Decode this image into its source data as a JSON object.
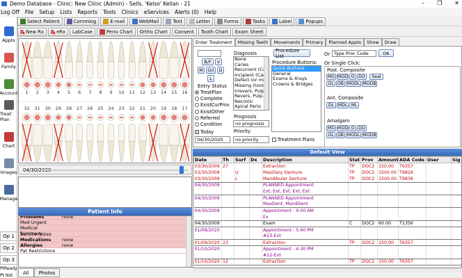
{
  "window": {
    "title": "Demo Database - Clinic: New Clinic (Admin) - Sells, 'Kelso' Kellan - 21"
  },
  "menu": [
    "Log Off",
    "File",
    "Setup",
    "Lists",
    "Reports",
    "Tools",
    "Clinics",
    "eServices",
    "Alerts (0)",
    "Help"
  ],
  "toolbar1": [
    {
      "label": "Select Patient",
      "icon": "person-icon",
      "color": "#3a7d2b"
    },
    {
      "label": "Commlog",
      "icon": "phone-icon",
      "color": "#5b5b9a"
    },
    {
      "label": "E-mail",
      "icon": "email-icon",
      "color": "#c9a227"
    },
    {
      "label": "WebMail",
      "icon": "webmail-icon",
      "color": "#3d72c4"
    },
    {
      "label": "Text",
      "icon": "text-icon",
      "color": "#9aa6b6"
    },
    {
      "label": "Letter",
      "icon": "letter-icon",
      "color": "#bdbdbd"
    },
    {
      "label": "Forms",
      "icon": "forms-icon",
      "color": "#8a8a8a"
    },
    {
      "label": "Tasks",
      "icon": "tasks-icon",
      "color": "#b23a3a"
    },
    {
      "label": "Label",
      "icon": "label-icon",
      "color": "#3d72c4"
    },
    {
      "label": "Popups",
      "icon": "popups-icon",
      "color": "#5b8bd4"
    }
  ],
  "toolbar2": [
    {
      "label": "New Rx",
      "rx": true
    },
    {
      "label": "eRx",
      "rx": true
    },
    {
      "label": "LabCase"
    },
    {
      "label": "Perio Chart",
      "icon": "perio-icon"
    },
    {
      "label": "Ortho Chart"
    },
    {
      "label": "Consent"
    },
    {
      "label": "Tooth Chart"
    },
    {
      "label": "Exam Sheet"
    }
  ],
  "sidebar": [
    {
      "label": "Appts",
      "color": "#2f6bd0"
    },
    {
      "label": "Family",
      "color": "#d5564e"
    },
    {
      "label": "Account",
      "color": "#4f8c3a"
    },
    {
      "label": "Treat' Plan",
      "color": "#5a5a5a"
    },
    {
      "label": "Chart",
      "color": "#c23b3b"
    },
    {
      "label": "Images",
      "color": "#7a8ca5"
    },
    {
      "label": "Manage",
      "color": "#4b6b9e"
    }
  ],
  "ops": [
    "Op 1",
    "Op 2",
    "Op 3"
  ],
  "sidebar_bottom": [
    "PtReady",
    "Pt Not"
  ],
  "tooth_chart": {
    "upper_numbers": [
      "1",
      "2",
      "3",
      "4",
      "5",
      "6",
      "7",
      "8",
      "9",
      "10",
      "11",
      "12",
      "13",
      "14",
      "15",
      "16"
    ],
    "lower_numbers": [
      "32",
      "31",
      "30",
      "29",
      "28",
      "27",
      "26",
      "25",
      "24",
      "23",
      "22",
      "21",
      "20",
      "19",
      "18",
      "17"
    ],
    "missing_teeth": [
      "1",
      "4",
      "13",
      "16",
      "32",
      "29",
      "20",
      "17"
    ]
  },
  "chart_date": "04/30/2020",
  "patient_info": {
    "title": "Patient Info",
    "rows": [
      {
        "k": "Problems",
        "v": "none",
        "pink": true,
        "bold": true
      },
      {
        "k": "Med Urgent",
        "v": "",
        "pink": true
      },
      {
        "k": "Medical Summary",
        "v": "",
        "pink": true
      },
      {
        "k": "Service Notes",
        "v": "",
        "pink": true
      },
      {
        "k": "Medications",
        "v": "none",
        "pink": true,
        "bold": true
      },
      {
        "k": "Allergies",
        "v": "none",
        "pink": true,
        "bold": true
      },
      {
        "k": "Pat Restrictions",
        "v": "",
        "pink": false
      }
    ]
  },
  "bottom_tabs": [
    "All",
    "Photos"
  ],
  "tx_tabs": [
    "Enter Treatment",
    "Missing Teeth",
    "Movements",
    "Primary",
    "Planned Appts",
    "Show",
    "Draw"
  ],
  "enter_tx": {
    "surf_buttons_row1": [
      "B/F",
      "V"
    ],
    "surf_buttons_row2": [
      "M",
      "O/I",
      "D"
    ],
    "surf_buttons_row3": [
      "L"
    ],
    "entry_status_label": "Entry Status",
    "statuses": [
      {
        "label": "TreatPlan",
        "on": true
      },
      {
        "label": "Complete",
        "on": false
      },
      {
        "label": "ExistCurProv",
        "on": false
      },
      {
        "label": "ExistOther",
        "on": false
      },
      {
        "label": "Referred",
        "on": false
      },
      {
        "label": "Condition",
        "on": false
      }
    ],
    "today_label": "Today",
    "today_checked": true,
    "date_value": "04/30/2020",
    "diagnosis_label": "Diagnosis",
    "diagnosis_items": [
      "None",
      "Caries",
      "Recurrent (Car)",
      "Incipient (Car)",
      "Defect (or miss",
      "Missing (tooth",
      "Irrevers. Pulp.",
      "Revers. Pulp.",
      "Necrotic",
      "Apical Perio"
    ],
    "prognosis_label": "Prognosis",
    "prognosis_value": "no prognosis",
    "priority_label": "Priority",
    "priority_value": "no priority",
    "treatment_plans_label": "Treatment Plans",
    "procedure_list_btn": "Procedure List",
    "proc_buttons_label": "Procedure Buttons:",
    "proc_categories": [
      "Quick Buttons",
      "General",
      "Exams & Xrays",
      "Crowns & Bridges"
    ],
    "or_label": "Or",
    "type_proc_placeholder": "Type Proc Code",
    "ok_label": "OK",
    "single_click_label": "Or Single Click:",
    "post_composite_label": "Post. Composite",
    "post_row1": [
      "MO",
      "MOD",
      "O",
      "DO"
    ],
    "seal_label": "Seal",
    "post_row2": [
      "OL",
      "OB",
      "MODL",
      "MODB"
    ],
    "ant_composite_label": "Ant. Composite",
    "ant_row": [
      "DL",
      "MDL",
      "ML"
    ],
    "amalgam_label": "Amalgam",
    "amal_row1": [
      "MO",
      "MOD",
      "O",
      "DO"
    ],
    "amal_row2": [
      "OL",
      "OB",
      "MODL",
      "MODB"
    ]
  },
  "grid": {
    "title": "Default View",
    "columns": [
      "Date",
      "Th",
      "Surf",
      "Dx",
      "Description",
      "Stat",
      "Prov",
      "Amount",
      "ADA Code",
      "User",
      "Sig"
    ],
    "rows": [
      {
        "cells": [
          "03/30/2009",
          "27",
          "",
          "",
          "Extraction",
          "TP",
          "DOC2",
          "150.00",
          "T6357",
          "",
          ""
        ],
        "color": "red",
        "sep": false
      },
      {
        "cells": [
          "03/30/2009",
          "",
          "U",
          "",
          "Maxillary Denture",
          "TP",
          "DOC2",
          "1500.00",
          "T9826",
          "",
          ""
        ],
        "color": "red",
        "sep": false
      },
      {
        "cells": [
          "03/30/2009",
          "",
          "L",
          "",
          "Mandibular Denture",
          "TP",
          "DOC2",
          "1500.00",
          "T9836",
          "",
          ""
        ],
        "color": "red",
        "sep": true
      },
      {
        "cells": [
          "04/30/2009",
          "",
          "",
          "",
          "PLANNED Appointment",
          "",
          "",
          "",
          "",
          "",
          ""
        ],
        "color": "purple",
        "sep": false
      },
      {
        "cells": [
          "",
          "",
          "",
          "",
          "Ext, Ext, Ext, Ext, Ext",
          "",
          "",
          "",
          "",
          "",
          ""
        ],
        "color": "purple",
        "sep": true
      },
      {
        "cells": [
          "04/30/2009",
          "",
          "",
          "",
          "PLANNED Appointment",
          "",
          "",
          "",
          "",
          "",
          ""
        ],
        "color": "purple",
        "sep": false
      },
      {
        "cells": [
          "",
          "",
          "",
          "",
          "MaxDent, MandDent",
          "",
          "",
          "",
          "",
          "",
          ""
        ],
        "color": "purple",
        "sep": true
      },
      {
        "cells": [
          "04/30/2009",
          "",
          "",
          "",
          "Appointment - 9:00 AM",
          "",
          "",
          "",
          "",
          "",
          ""
        ],
        "color": "purple",
        "sep": false
      },
      {
        "cells": [
          "",
          "",
          "",
          "",
          "Ex",
          "",
          "",
          "",
          "",
          "",
          ""
        ],
        "color": "purple",
        "sep": true
      },
      {
        "cells": [
          "04/30/2009",
          "",
          "",
          "",
          "Exam",
          "C",
          "DOC2",
          "60.00",
          "T1356",
          "",
          ""
        ],
        "color": "black",
        "sep": true
      },
      {
        "cells": [
          "01/09/2020",
          "",
          "",
          "",
          "Appointment - 5:40 PM",
          "",
          "",
          "",
          "",
          "",
          ""
        ],
        "color": "purple",
        "sep": false
      },
      {
        "cells": [
          "",
          "",
          "",
          "",
          "#23-Ext",
          "",
          "",
          "",
          "",
          "",
          ""
        ],
        "color": "purple",
        "sep": true
      },
      {
        "cells": [
          "01/09/2020",
          "23",
          "",
          "",
          "Extraction",
          "TP",
          "DOC2",
          "150.00",
          "T6357",
          "",
          ""
        ],
        "color": "red",
        "sep": true
      },
      {
        "cells": [
          "01/10/2020",
          "",
          "",
          "",
          "Appointment - 4:30 PM",
          "",
          "",
          "",
          "",
          "",
          ""
        ],
        "color": "purple",
        "sep": false
      },
      {
        "cells": [
          "",
          "",
          "",
          "",
          "#12-Ext",
          "",
          "",
          "",
          "",
          "",
          ""
        ],
        "color": "purple",
        "sep": true
      },
      {
        "cells": [
          "01/10/2020",
          "12",
          "",
          "",
          "Extraction",
          "TP",
          "DOC2",
          "150.00",
          "T6357",
          "",
          ""
        ],
        "color": "red",
        "sep": true
      }
    ]
  }
}
